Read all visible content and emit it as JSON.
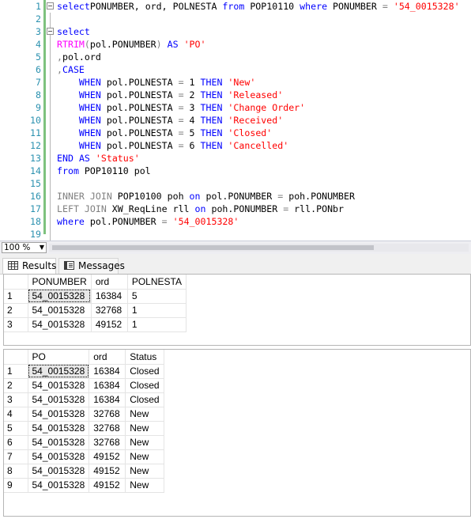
{
  "editor": {
    "lines": [
      {
        "n": "1",
        "tokens": [
          [
            "kw",
            "select"
          ],
          [
            "",
            "PONUMBER, ord, POLNESTA "
          ],
          [
            "kw",
            "from"
          ],
          [
            "",
            " POP10110 "
          ],
          [
            "kw",
            "where"
          ],
          [
            "",
            " PONUMBER "
          ],
          [
            "grey",
            "="
          ],
          [
            "",
            " "
          ],
          [
            "str",
            "'54_0015328'"
          ]
        ]
      },
      {
        "n": "2",
        "tokens": []
      },
      {
        "n": "3",
        "tokens": [
          [
            "kw",
            "select"
          ]
        ]
      },
      {
        "n": "4",
        "tokens": [
          [
            "fn",
            "RTRIM"
          ],
          [
            "grey",
            "("
          ],
          [
            "",
            "pol.PONUMBER"
          ],
          [
            "grey",
            ")"
          ],
          [
            "",
            " "
          ],
          [
            "kw",
            "AS"
          ],
          [
            "",
            " "
          ],
          [
            "str",
            "'PO'"
          ]
        ]
      },
      {
        "n": "5",
        "tokens": [
          [
            "grey",
            ","
          ],
          [
            "",
            "pol.ord"
          ]
        ]
      },
      {
        "n": "6",
        "tokens": [
          [
            "grey",
            ","
          ],
          [
            "kw",
            "CASE"
          ]
        ]
      },
      {
        "n": "7",
        "tokens": [
          [
            "",
            "    "
          ],
          [
            "kw",
            "WHEN"
          ],
          [
            "",
            " pol.POLNESTA "
          ],
          [
            "grey",
            "="
          ],
          [
            "",
            " 1 "
          ],
          [
            "kw",
            "THEN"
          ],
          [
            "",
            " "
          ],
          [
            "str",
            "'New'"
          ]
        ]
      },
      {
        "n": "8",
        "tokens": [
          [
            "",
            "    "
          ],
          [
            "kw",
            "WHEN"
          ],
          [
            "",
            " pol.POLNESTA "
          ],
          [
            "grey",
            "="
          ],
          [
            "",
            " 2 "
          ],
          [
            "kw",
            "THEN"
          ],
          [
            "",
            " "
          ],
          [
            "str",
            "'Released'"
          ]
        ]
      },
      {
        "n": "9",
        "tokens": [
          [
            "",
            "    "
          ],
          [
            "kw",
            "WHEN"
          ],
          [
            "",
            " pol.POLNESTA "
          ],
          [
            "grey",
            "="
          ],
          [
            "",
            " 3 "
          ],
          [
            "kw",
            "THEN"
          ],
          [
            "",
            " "
          ],
          [
            "str",
            "'Change Order'"
          ]
        ]
      },
      {
        "n": "10",
        "tokens": [
          [
            "",
            "    "
          ],
          [
            "kw",
            "WHEN"
          ],
          [
            "",
            " pol.POLNESTA "
          ],
          [
            "grey",
            "="
          ],
          [
            "",
            " 4 "
          ],
          [
            "kw",
            "THEN"
          ],
          [
            "",
            " "
          ],
          [
            "str",
            "'Received'"
          ]
        ]
      },
      {
        "n": "11",
        "tokens": [
          [
            "",
            "    "
          ],
          [
            "kw",
            "WHEN"
          ],
          [
            "",
            " pol.POLNESTA "
          ],
          [
            "grey",
            "="
          ],
          [
            "",
            " 5 "
          ],
          [
            "kw",
            "THEN"
          ],
          [
            "",
            " "
          ],
          [
            "str",
            "'Closed'"
          ]
        ]
      },
      {
        "n": "12",
        "tokens": [
          [
            "",
            "    "
          ],
          [
            "kw",
            "WHEN"
          ],
          [
            "",
            " pol.POLNESTA "
          ],
          [
            "grey",
            "="
          ],
          [
            "",
            " 6 "
          ],
          [
            "kw",
            "THEN"
          ],
          [
            "",
            " "
          ],
          [
            "str",
            "'Cancelled'"
          ]
        ]
      },
      {
        "n": "13",
        "tokens": [
          [
            "kw",
            "END"
          ],
          [
            "",
            " "
          ],
          [
            "kw",
            "AS"
          ],
          [
            "",
            " "
          ],
          [
            "str",
            "'Status'"
          ]
        ]
      },
      {
        "n": "14",
        "tokens": [
          [
            "kw",
            "from"
          ],
          [
            "",
            " POP10110 pol"
          ]
        ]
      },
      {
        "n": "15",
        "tokens": []
      },
      {
        "n": "16",
        "tokens": [
          [
            "grey",
            "INNER JOIN"
          ],
          [
            "",
            " POP10100 poh "
          ],
          [
            "kw",
            "on"
          ],
          [
            "",
            " pol.PONUMBER "
          ],
          [
            "grey",
            "="
          ],
          [
            "",
            " poh.PONUMBER"
          ]
        ]
      },
      {
        "n": "17",
        "tokens": [
          [
            "grey",
            "LEFT JOIN"
          ],
          [
            "",
            " XW_ReqLine rll "
          ],
          [
            "kw",
            "on"
          ],
          [
            "",
            " poh.PONUMBER "
          ],
          [
            "grey",
            "="
          ],
          [
            "",
            " rll.PONbr"
          ]
        ]
      },
      {
        "n": "18",
        "tokens": [
          [
            "kw",
            "where"
          ],
          [
            "",
            " pol.PONUMBER "
          ],
          [
            "grey",
            "="
          ],
          [
            "",
            " "
          ],
          [
            "str",
            "'54_0015328'"
          ]
        ]
      },
      {
        "n": "19",
        "tokens": []
      }
    ],
    "fold_lines": [
      "1",
      "3"
    ]
  },
  "zoom": {
    "value": "100 %"
  },
  "tabs": {
    "results": "Results",
    "messages": "Messages"
  },
  "grid1": {
    "columns": [
      "PONUMBER",
      "ord",
      "POLNESTA"
    ],
    "rows": [
      [
        "1",
        "54_0015328",
        "16384",
        "5"
      ],
      [
        "2",
        "54_0015328",
        "32768",
        "1"
      ],
      [
        "3",
        "54_0015328",
        "49152",
        "1"
      ]
    ]
  },
  "grid2": {
    "columns": [
      "PO",
      "ord",
      "Status"
    ],
    "rows": [
      [
        "1",
        "54_0015328",
        "16384",
        "Closed"
      ],
      [
        "2",
        "54_0015328",
        "16384",
        "Closed"
      ],
      [
        "3",
        "54_0015328",
        "16384",
        "Closed"
      ],
      [
        "4",
        "54_0015328",
        "32768",
        "New"
      ],
      [
        "5",
        "54_0015328",
        "32768",
        "New"
      ],
      [
        "6",
        "54_0015328",
        "32768",
        "New"
      ],
      [
        "7",
        "54_0015328",
        "49152",
        "New"
      ],
      [
        "8",
        "54_0015328",
        "49152",
        "New"
      ],
      [
        "9",
        "54_0015328",
        "49152",
        "New"
      ]
    ]
  }
}
